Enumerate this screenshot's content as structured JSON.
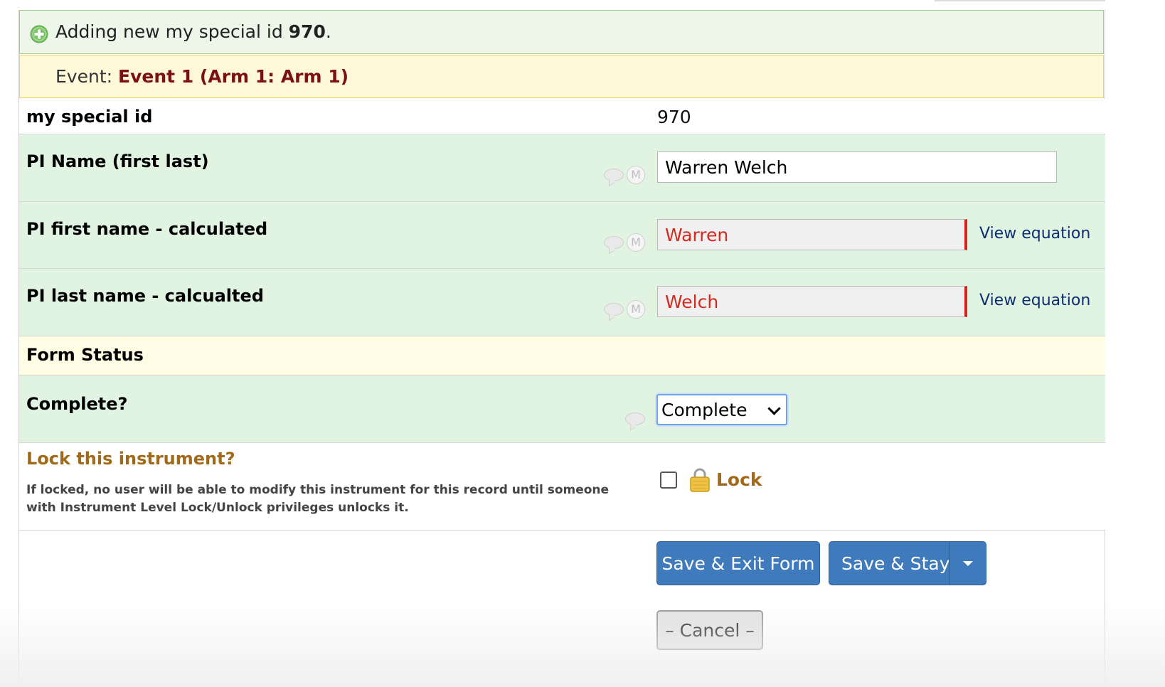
{
  "banner": {
    "prefix": "Adding new my special id ",
    "record_id": "970",
    "suffix": "."
  },
  "event": {
    "label": "Event: ",
    "value": "Event 1 (Arm 1: Arm 1)"
  },
  "fields": {
    "special_id": {
      "label": "my special id",
      "value": "970"
    },
    "pi_name": {
      "label": "PI Name (first last)",
      "value": "Warren Welch"
    },
    "pi_first": {
      "label": "PI first name - calculated",
      "value": "Warren",
      "link": "View equation"
    },
    "pi_last": {
      "label": "PI last name - calcualted",
      "value": "Welch",
      "link": "View equation"
    }
  },
  "form_status": {
    "header": "Form Status",
    "complete_label": "Complete?",
    "complete_value": "Complete"
  },
  "lock": {
    "title": "Lock this instrument?",
    "description": "If locked, no user will be able to modify this instrument for this record until someone with Instrument Level Lock/Unlock privileges unlocks it.",
    "label": "Lock"
  },
  "buttons": {
    "save_exit": "Save & Exit Form",
    "save_stay": "Save & Stay",
    "cancel": "– Cancel –"
  },
  "colors": {
    "calc_text": "#d52a1f",
    "event_value": "#7a1010",
    "lock_title": "#a06a1a",
    "button_blue": "#3f7abd"
  }
}
